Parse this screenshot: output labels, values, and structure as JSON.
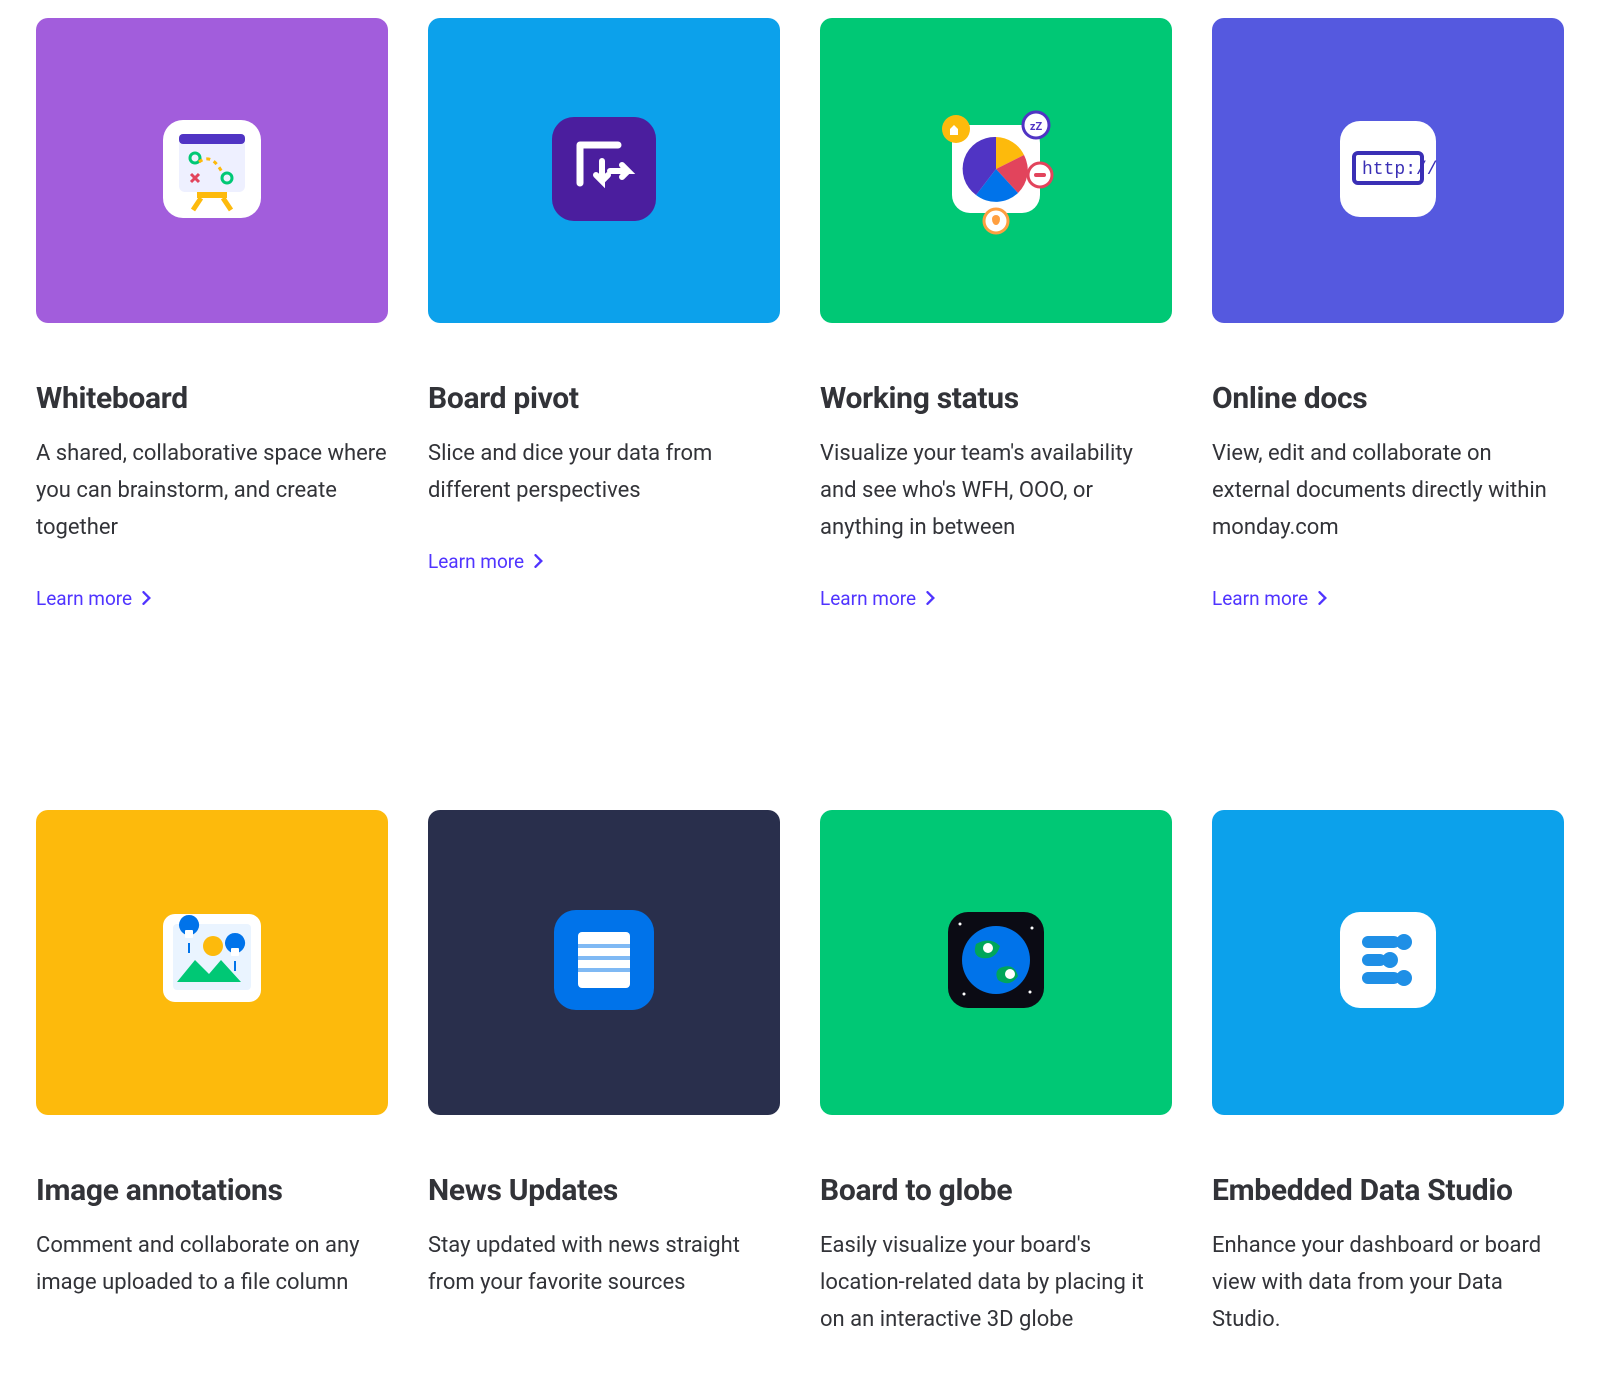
{
  "learn_more_label": "Learn more",
  "cards": [
    {
      "id": "whiteboard",
      "title": "Whiteboard",
      "desc": "A shared, collaborative space where you can brainstorm, and create together",
      "tile_color": "#A25DDC",
      "has_learn_more": true
    },
    {
      "id": "board-pivot",
      "title": "Board pivot",
      "desc": "Slice and dice your data from different perspectives",
      "tile_color": "#0CA1EB",
      "has_learn_more": true
    },
    {
      "id": "working-status",
      "title": "Working status",
      "desc": "Visualize your team's availability and see who's WFH, OOO, or anything in between",
      "tile_color": "#00C875",
      "has_learn_more": true
    },
    {
      "id": "online-docs",
      "title": "Online docs",
      "desc": "View, edit and collaborate on external documents directly within monday.com",
      "tile_color": "#5559DF",
      "has_learn_more": true
    },
    {
      "id": "image-annotations",
      "title": "Image annotations",
      "desc": "Comment and collaborate on any image uploaded to a file column",
      "tile_color": "#FDBA0C",
      "has_learn_more": false
    },
    {
      "id": "news-updates",
      "title": "News Updates",
      "desc": "Stay updated with news straight from your favorite sources",
      "tile_color": "#292F4C",
      "has_learn_more": false
    },
    {
      "id": "board-to-globe",
      "title": "Board to globe",
      "desc": "Easily visualize your board's location-related data by placing it on an interactive 3D globe",
      "tile_color": "#00C875",
      "has_learn_more": false
    },
    {
      "id": "embedded-data-studio",
      "title": "Embedded Data Studio",
      "desc": "Enhance your dashboard or board view with data from your Data Studio.",
      "tile_color": "#0CA1EB",
      "has_learn_more": false
    }
  ]
}
